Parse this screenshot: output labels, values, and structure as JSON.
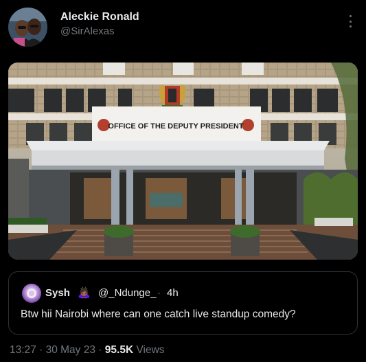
{
  "tweet": {
    "author_name": "Aleckie Ronald",
    "author_handle": "@SirAlexas",
    "more_icon": "more-vertical-icon",
    "photo": {
      "sign_text": "OFFICE OF THE DEPUTY PRESIDENT"
    }
  },
  "quoted_tweet": {
    "author_name": "Sysh",
    "name_emoji": "🙇🏾‍♀️",
    "author_handle": "@_Ndunge_",
    "separator": "·",
    "time": "4h",
    "text": "Btw hii Nairobi where can one catch live standup comedy?"
  },
  "meta": {
    "time": "13:27",
    "sep1": "·",
    "date": "30 May 23",
    "sep2": "·",
    "views_count": "95.5K",
    "views_label": "Views"
  }
}
